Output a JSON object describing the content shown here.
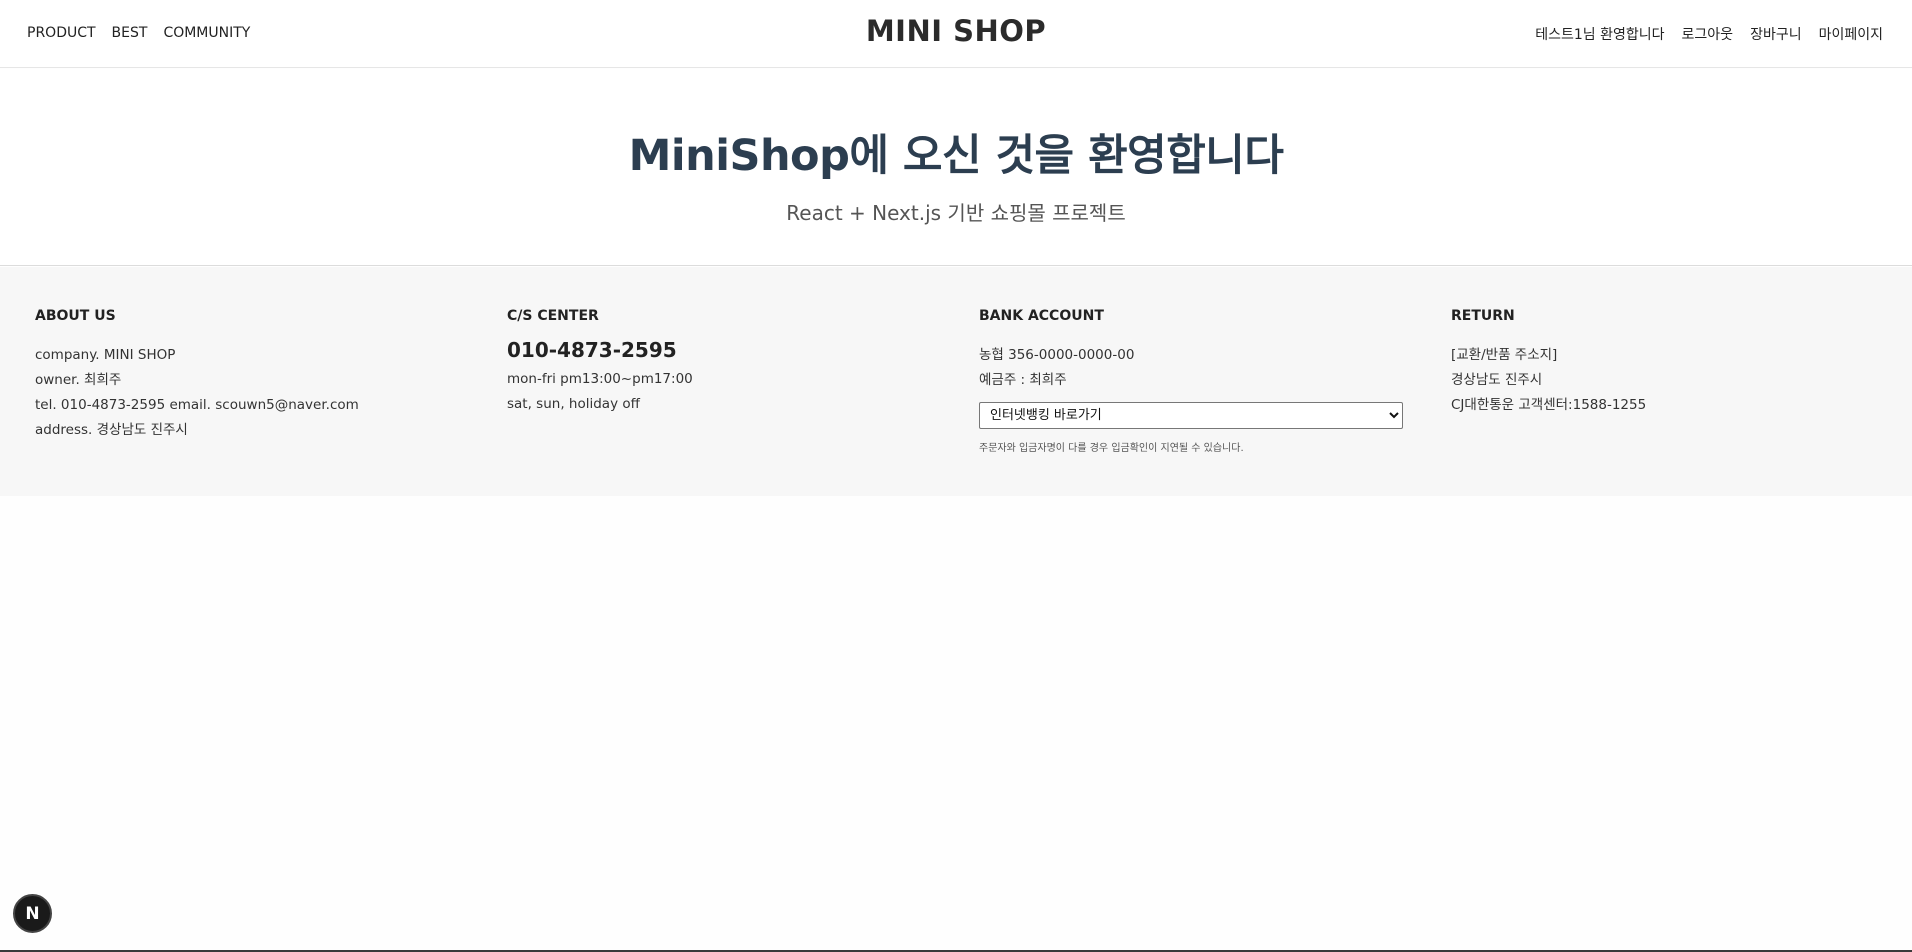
{
  "header": {
    "nav_left": [
      "PRODUCT",
      "BEST",
      "COMMUNITY"
    ],
    "logo": "MINI SHOP",
    "nav_right": [
      "테스트1님 환영합니다",
      "로그아웃",
      "장바구니",
      "마이페이지"
    ]
  },
  "hero": {
    "title": "MiniShop에 오신 것을 환영합니다",
    "subtitle": "React + Next.js 기반 쇼핑몰 프로젝트"
  },
  "footer": {
    "about": {
      "heading": "ABOUT US",
      "lines": [
        "company. MINI SHOP",
        "owner. 최희주",
        "tel. 010-4873-2595 email. scouwn5@naver.com",
        "address. 경상남도 진주시"
      ]
    },
    "cs": {
      "heading": "C/S CENTER",
      "phone": "010-4873-2595",
      "lines": [
        "mon-fri pm13:00~pm17:00",
        "sat, sun, holiday off"
      ]
    },
    "bank": {
      "heading": "BANK ACCOUNT",
      "lines": [
        "농협 356-0000-0000-00",
        "예금주 : 최희주"
      ],
      "select_value": "인터넷뱅킹 바로가기",
      "note": "주문자와 입금자명이 다를 경우 입금확인이 지연될 수 있습니다."
    },
    "return": {
      "heading": "RETURN",
      "lines": [
        "[교환/반품 주소지]",
        "경상남도 진주시",
        "CJ대한통운 고객센터:1588-1255"
      ]
    }
  },
  "badge": {
    "label": "N"
  },
  "colors": {
    "hero_title": "#2c3e50",
    "footer_bg": "#f7f7f7",
    "badge_bg": "#1a1a1a"
  }
}
